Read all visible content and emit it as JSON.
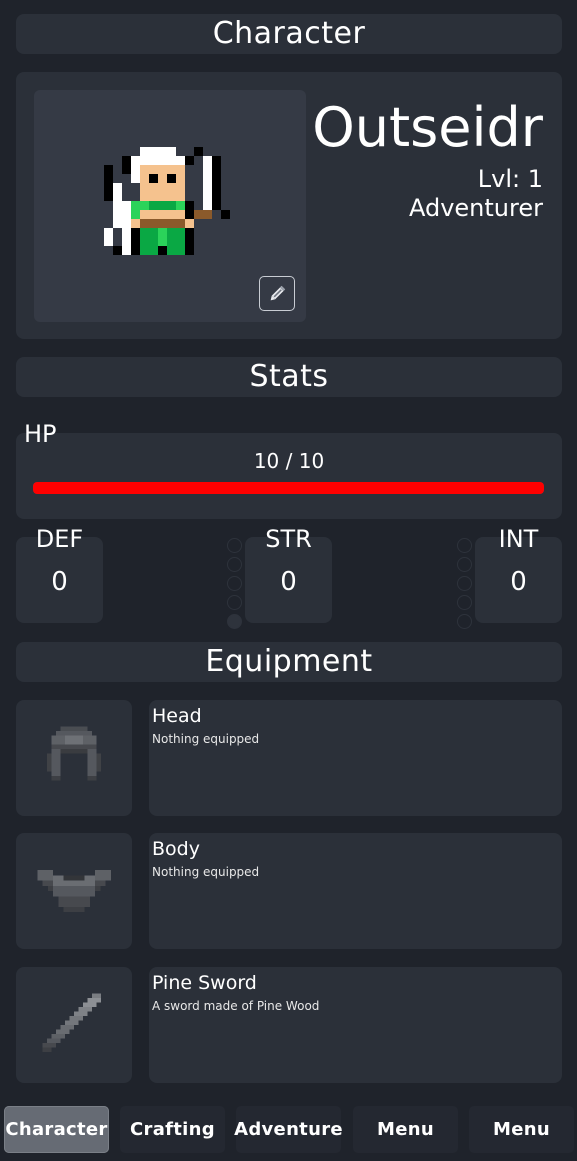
{
  "headers": {
    "character": "Character",
    "stats": "Stats",
    "equipment": "Equipment"
  },
  "character": {
    "name": "Outseidr",
    "level": "Lvl: 1",
    "class": "Adventurer",
    "edit_icon": "pencil-icon"
  },
  "stats": {
    "hp_label": "HP",
    "hp_text": "10 / 10",
    "hp_fraction": 1.0,
    "hp_color": "#ff0000",
    "def": {
      "label": "DEF",
      "value": "0"
    },
    "str": {
      "label": "STR",
      "value": "0"
    },
    "int": {
      "label": "INT",
      "value": "0"
    }
  },
  "equipment": [
    {
      "slot": "Head",
      "description": "Nothing equipped",
      "icon": "helmet-icon"
    },
    {
      "slot": "Body",
      "description": "Nothing equipped",
      "icon": "chest-armor-icon"
    },
    {
      "slot": "Pine Sword",
      "description": "A sword made of Pine Wood",
      "icon": "sword-icon"
    }
  ],
  "nav": {
    "items": [
      "Character",
      "Crafting",
      "Adventure",
      "Menu",
      "Menu"
    ],
    "active": "Character"
  }
}
